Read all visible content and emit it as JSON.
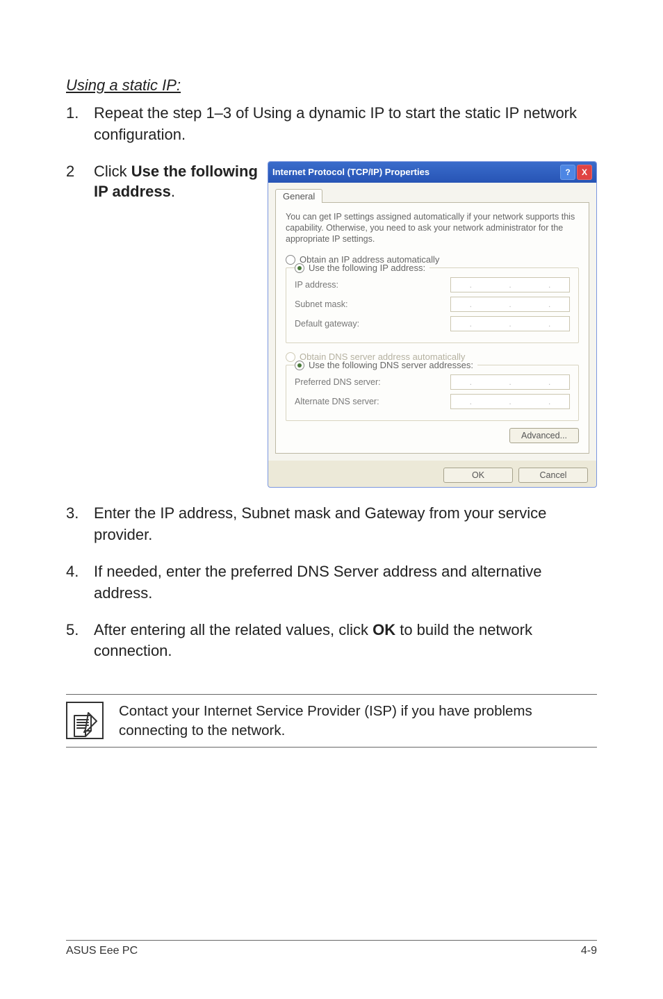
{
  "heading": "Using a static IP:",
  "steps": {
    "1": {
      "n": "1.",
      "text": "Repeat the step 1–3 of Using a dynamic IP to start the static IP network configuration."
    },
    "2": {
      "n": "2",
      "text_prefix": "Click ",
      "bold": "Use the following IP address",
      "text_suffix": "."
    },
    "3": {
      "n": "3.",
      "text": "Enter the IP address, Subnet mask and Gateway from your service provider."
    },
    "4": {
      "n": "4.",
      "text": "If needed, enter the preferred DNS Server address and alternative address."
    },
    "5": {
      "n": "5.",
      "prefix": "After entering all the related values, click ",
      "bold": "OK",
      "suffix": " to build the network connection."
    }
  },
  "dialog": {
    "title": "Internet Protocol (TCP/IP) Properties",
    "help_glyph": "?",
    "close_glyph": "X",
    "tab": "General",
    "description": "You can get IP settings assigned automatically if your network supports this capability. Otherwise, you need to ask your network administrator for the appropriate IP settings.",
    "r_auto_ip": "Obtain an IP address automatically",
    "r_use_ip": "Use the following IP address:",
    "lbl_ip": "IP address:",
    "lbl_subnet": "Subnet mask:",
    "lbl_gateway": "Default gateway:",
    "r_auto_dns": "Obtain DNS server address automatically",
    "r_use_dns": "Use the following DNS server addresses:",
    "lbl_pref_dns": "Preferred DNS server:",
    "lbl_alt_dns": "Alternate DNS server:",
    "btn_adv": "Advanced...",
    "btn_ok": "OK",
    "btn_cancel": "Cancel"
  },
  "note": "Contact your Internet Service Provider (ISP) if you have problems connecting to the network.",
  "footer": {
    "left": "ASUS Eee PC",
    "right": "4-9"
  }
}
